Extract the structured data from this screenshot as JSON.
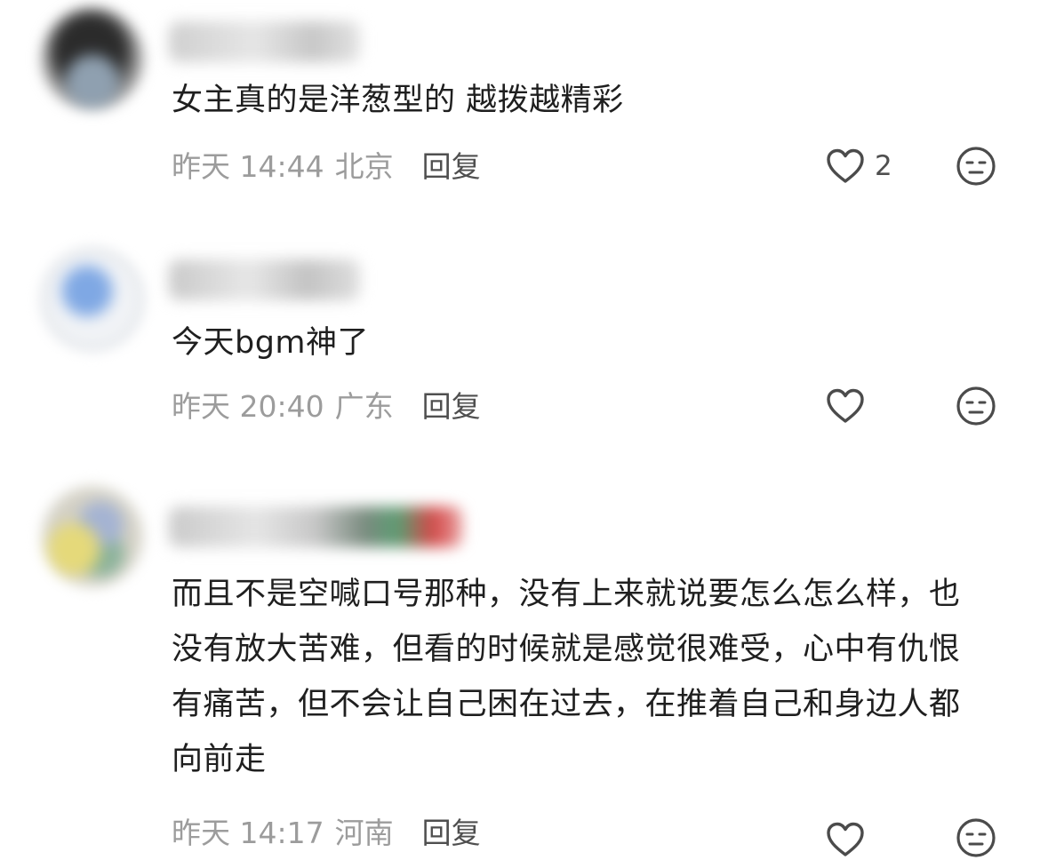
{
  "comments": [
    {
      "text": "女主真的是洋葱型的 越拨越精彩",
      "time": "昨天 14:44",
      "location": "北京",
      "reply_label": "回复",
      "likes": "2",
      "avatar_icon": "user-avatar-blurred",
      "like_icon": "heart-outline-icon",
      "dislike_icon": "neutral-face-icon"
    },
    {
      "text": "今天bgm神了",
      "time": "昨天 20:40",
      "location": "广东",
      "reply_label": "回复",
      "likes": "",
      "avatar_icon": "user-avatar-blurred",
      "like_icon": "heart-outline-icon",
      "dislike_icon": "neutral-face-icon"
    },
    {
      "text": "而且不是空喊口号那种，没有上来就说要怎么怎么样，也没有放大苦难，但看的时候就是感觉很难受，心中有仇恨有痛苦，但不会让自己困在过去，在推着自己和身边人都向前走",
      "time": "昨天 14:17",
      "location": "河南",
      "reply_label": "回复",
      "likes": "",
      "avatar_icon": "user-avatar-blurred",
      "like_icon": "heart-outline-icon",
      "dislike_icon": "neutral-face-icon"
    }
  ],
  "colors": {
    "text": "#1f1f1f",
    "meta": "#9c9c9c",
    "action": "#4f4f4f"
  }
}
